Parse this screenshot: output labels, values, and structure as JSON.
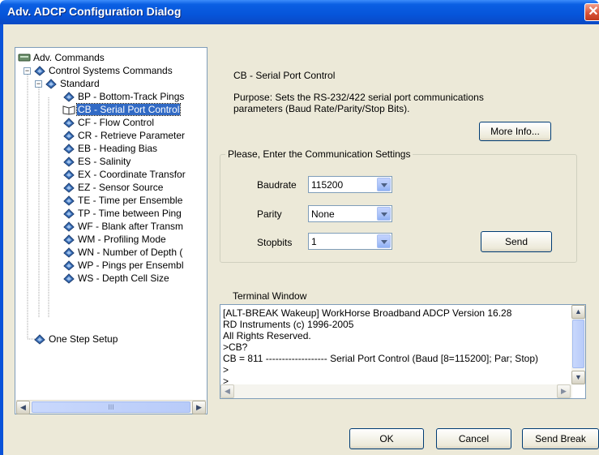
{
  "window": {
    "title": "Adv. ADCP Configuration Dialog",
    "close_glyph": "✕"
  },
  "tree": {
    "root": "Adv. Commands",
    "group": "Control Systems Commands",
    "subgroup": "Standard",
    "items": [
      "BP - Bottom-Track Pings",
      "CB - Serial Port Control",
      "CF - Flow Control",
      "CR - Retrieve Parameter",
      "EB - Heading Bias",
      "ES - Salinity",
      "EX - Coordinate Transfor",
      "EZ - Sensor Source",
      "TE - Time per Ensemble",
      "TP - Time between Ping",
      "WF - Blank after Transm",
      "WM - Profiling Mode",
      "WN - Number of Depth (",
      "WP - Pings per Ensembl",
      "WS - Depth Cell Size"
    ],
    "selected_index": 1,
    "one_step": "One Step Setup",
    "scroll_grip": "III"
  },
  "detail": {
    "command_title": "CB - Serial Port Control",
    "purpose_line1": "Purpose:  Sets the RS-232/422 serial port communications",
    "purpose_line2": "parameters (Baud Rate/Parity/Stop Bits).",
    "more_info": "More Info..."
  },
  "settings": {
    "legend": "Please, Enter the Communication Settings",
    "baudrate_label": "Baudrate",
    "baudrate_value": "115200",
    "parity_label": "Parity",
    "parity_value": "None",
    "stopbits_label": "Stopbits",
    "stopbits_value": "1",
    "send": "Send"
  },
  "terminal": {
    "label": "Terminal Window",
    "lines": [
      "[ALT-BREAK Wakeup] WorkHorse Broadband ADCP Version 16.28",
      "RD Instruments (c) 1996-2005",
      "All Rights Reserved.",
      ">CB?",
      "CB = 811 ------------------- Serial Port Control (Baud [8=115200]; Par; Stop)",
      ">",
      ">"
    ]
  },
  "footer": {
    "ok": "OK",
    "cancel": "Cancel",
    "send_break": "Send Break"
  }
}
